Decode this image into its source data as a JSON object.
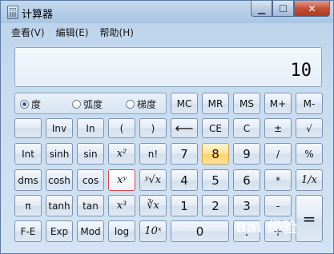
{
  "window": {
    "title": "计算器"
  },
  "menu": [
    {
      "label": "查看(V)"
    },
    {
      "label": "编辑(E)"
    },
    {
      "label": "帮助(H)"
    }
  ],
  "display": {
    "value": "10"
  },
  "angle_units": [
    {
      "label": "度",
      "selected": true
    },
    {
      "label": "弧度",
      "selected": false
    },
    {
      "label": "梯度",
      "selected": false
    }
  ],
  "memory_buttons": [
    "MC",
    "MR",
    "MS",
    "M+",
    "M-"
  ],
  "buttons": {
    "inv": "Inv",
    "ln": "In",
    "lparen": "(",
    "rparen": ")",
    "back": "⟵",
    "ce": "CE",
    "c": "C",
    "pm": "±",
    "sqrt": "√",
    "int": "Int",
    "sinh": "sinh",
    "sin": "sin",
    "x2": "x²",
    "fact": "n!",
    "d7": "7",
    "d8": "8",
    "d9": "9",
    "div": "/",
    "pct": "%",
    "dms": "dms",
    "cosh": "cosh",
    "cos": "cos",
    "xy": "xʸ",
    "yroot": "ʸ√x",
    "d4": "4",
    "d5": "5",
    "d6": "6",
    "mul": "*",
    "recip": "1/x",
    "pi": "π",
    "tanh": "tanh",
    "tan": "tan",
    "x3": "x³",
    "cbrt": "∛x",
    "d1": "1",
    "d2": "2",
    "d3": "3",
    "sub": "-",
    "eq": "=",
    "fe": "F-E",
    "exp": "Exp",
    "mod": "Mod",
    "log": "log",
    "tenx": "10ˣ",
    "d0": "0",
    "dot": ".",
    "add": "+"
  },
  "watermark": "Bai 经验"
}
